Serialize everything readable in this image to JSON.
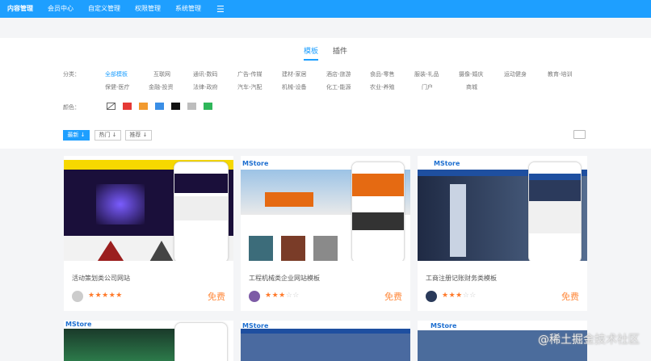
{
  "nav": {
    "items": [
      "内容管理",
      "会员中心",
      "自定义管理",
      "权限管理",
      "系统管理"
    ],
    "menu_icon": "hamburger-icon"
  },
  "tabs": [
    "模板",
    "插件"
  ],
  "filter": {
    "category_label": "分类：",
    "color_label": "颜色：",
    "categories_row1": [
      "全部模板",
      "互联网",
      "通讯-数码",
      "广告-传媒",
      "建材-家居",
      "酒店-旅游",
      "食品-零售",
      "服装-礼品",
      "摄像-婚庆",
      "运动健身",
      "教育-培训"
    ],
    "categories_row2": [
      "保健-医疗",
      "金融-投资",
      "法律-政府",
      "汽车-汽配",
      "机械-设备",
      "化工-能源",
      "农业-养殖",
      "门户",
      "商城"
    ],
    "colors": [
      "#ffffff",
      "#e53935",
      "#f29a2e",
      "#3a8ee6",
      "#111111",
      "#bdbdbd",
      "#2fb65a"
    ]
  },
  "sort": {
    "newest": "最新",
    "hot": "热门",
    "recommend": "推荐"
  },
  "cards": [
    {
      "title": "活动策划类公司网站",
      "rating": 5,
      "price": "免费",
      "brand": "",
      "accent": "#e8382f"
    },
    {
      "title": "工程机械类企业网站模板",
      "rating": 3,
      "price": "免费",
      "brand": "MStore",
      "accent": "#1e6fd0"
    },
    {
      "title": "工商注册记账财务类模板",
      "rating": 3,
      "price": "免费",
      "brand": "MStore",
      "accent": "#1e6fd0"
    }
  ],
  "bottom_cards": [
    {
      "brand": "MStore"
    },
    {
      "brand": "MStore"
    },
    {
      "brand": "MStore"
    }
  ],
  "watermark": "@稀土掘金技术社区"
}
